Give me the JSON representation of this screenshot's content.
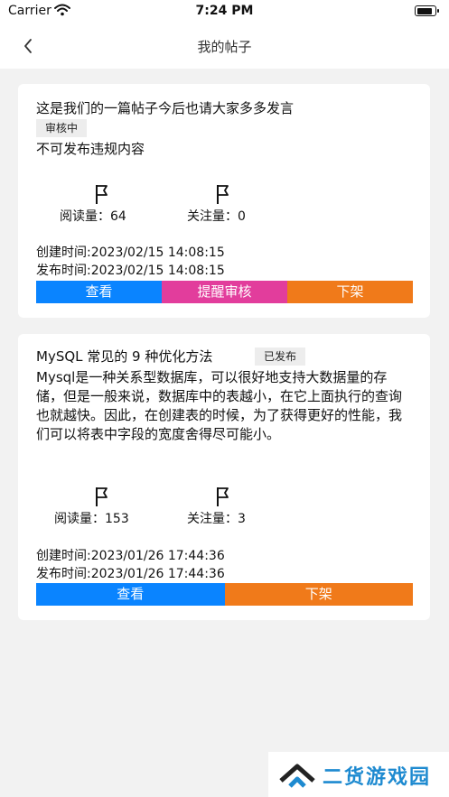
{
  "status_bar": {
    "carrier": "Carrier",
    "time": "7:24 PM",
    "battery_level": 0.9
  },
  "nav": {
    "title": "我的帖子",
    "back_icon": "chevron-left-icon"
  },
  "posts": [
    {
      "title": "这是我们的一篇帖子今后也请大家多多发言",
      "status": "审核中",
      "content": "不可发布违规内容",
      "read_label": "阅读量：64",
      "follow_label": "关注量：0",
      "created": "创建时间:2023/02/15 14:08:15",
      "published": "发布时间:2023/02/15 14:08:15",
      "buttons": [
        {
          "label": "查看",
          "color": "#0a84ff"
        },
        {
          "label": "提醒审核",
          "color": "#e23d9c"
        },
        {
          "label": "下架",
          "color": "#f07a1a"
        }
      ]
    },
    {
      "title": "MySQL 常见的 9 种优化方法",
      "status": "已发布",
      "content": "Mysql是一种关系型数据库，可以很好地支持大数据量的存储，但是一般来说，数据库中的表越小，在它上面执行的查询也就越快。因此，在创建表的时候，为了获得更好的性能，我们可以将表中字段的宽度舍得尽可能小。",
      "read_label": "阅读量：153",
      "follow_label": "关注量：3",
      "created": "创建时间:2023/01/26 17:44:36",
      "published": "发布时间:2023/01/26 17:44:36",
      "buttons": [
        {
          "label": "查看",
          "color": "#0a84ff"
        },
        {
          "label": "下架",
          "color": "#f07a1a"
        }
      ]
    }
  ],
  "watermark": {
    "text": "二货游戏园",
    "color": "#1e8ad0"
  }
}
